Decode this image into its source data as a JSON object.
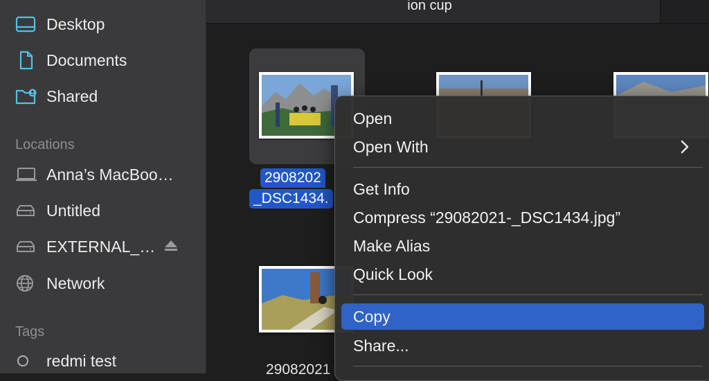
{
  "sidebar": {
    "favorites": [
      {
        "label": "Desktop",
        "icon": "desktop-icon"
      },
      {
        "label": "Documents",
        "icon": "document-icon"
      },
      {
        "label": "Shared",
        "icon": "shared-folder-icon"
      }
    ],
    "locations_title": "Locations",
    "locations": [
      {
        "label": "Anna’s MacBoo…",
        "icon": "laptop-icon"
      },
      {
        "label": "Untitled",
        "icon": "drive-icon"
      },
      {
        "label": "EXTERNAL_…",
        "icon": "drive-icon"
      },
      {
        "label": "Network",
        "icon": "globe-icon"
      }
    ],
    "tags_title": "Tags",
    "tags": [
      {
        "label": "redmi test",
        "icon": "tag-circle-icon"
      }
    ]
  },
  "main": {
    "window_title": "ion cup",
    "selected_file": {
      "line1": "2908202",
      "line2": "_DSC1434."
    },
    "other_file_partial": "29082021"
  },
  "context_menu": {
    "items": [
      "Open",
      "Open With",
      "Get Info",
      "Compress “29082021-_DSC1434.jpg”",
      "Make Alias",
      "Quick Look",
      "Copy",
      "Share..."
    ],
    "highlighted": "Copy"
  },
  "colors": {
    "accent": "#2f63c7",
    "sidebar_icon": "#4fc3e8",
    "sidebar_bg": "#3a3a3c",
    "main_bg": "#1e1e1e"
  }
}
